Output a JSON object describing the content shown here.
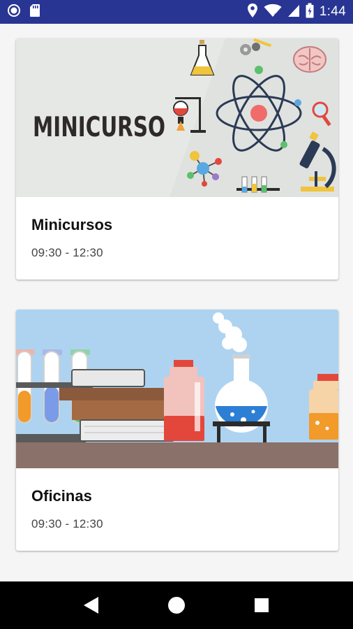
{
  "status_bar": {
    "time": "1:44",
    "icons": [
      "record-icon",
      "sd-card-icon",
      "location-icon",
      "wifi-icon",
      "signal-icon",
      "battery-icon"
    ]
  },
  "cards": [
    {
      "image_text": "MINICURSO",
      "title": "Minicursos",
      "time": "09:30 - 12:30"
    },
    {
      "title": "Oficinas",
      "time": "09:30 - 12:30"
    }
  ],
  "nav_bar": {
    "icons": [
      "back-icon",
      "home-icon",
      "recents-icon"
    ]
  },
  "colors": {
    "status_bar": "#283593",
    "card_bg": "#ffffff",
    "page_bg": "#f5f5f5",
    "nav_bar": "#000000"
  }
}
